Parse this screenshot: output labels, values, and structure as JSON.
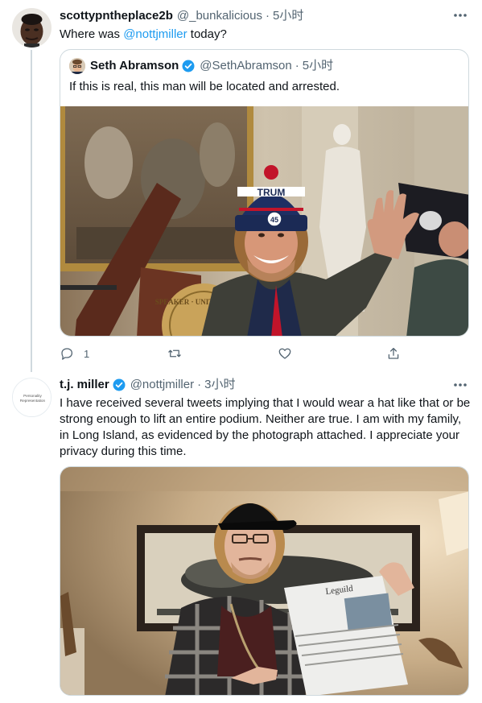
{
  "tweet1": {
    "author_name": "scottypntheplace2b",
    "author_handle": "@_bunkalicious",
    "separator": "·",
    "time": "5小时",
    "text_before": "Where was ",
    "mention": "@nottjmiller",
    "text_after": " today?",
    "quote": {
      "author_name": "Seth Abramson",
      "author_handle": "@SethAbramson",
      "separator": "·",
      "time": "5小时",
      "text": "If this is real, this man will be located and arrested.",
      "photo_lettering": {
        "hat": "TRUM",
        "hat_badge": "45",
        "seal": "SPEAKER · UNITED STATES"
      }
    },
    "actions": {
      "reply_count": "1",
      "retweet_count": "",
      "like_count": ""
    }
  },
  "tweet2": {
    "author_name": "t.j. miller",
    "author_handle": "@nottjmiller",
    "separator": "·",
    "time": "3小时",
    "avatar_text": [
      "Personality",
      "Representation"
    ],
    "text": "I have received several tweets implying that I would wear a hat like that or be strong enough to lift an entire podium. Neither are true. I am with my family, in Long Island, as evidenced by the photograph attached. I appreciate your privacy during this time.",
    "photo_lettering": {
      "newspaper_masthead": "Leguild"
    }
  },
  "icons": {
    "more": "more-horizontal-icon",
    "verified": "verified-badge-icon",
    "reply": "reply-icon",
    "retweet": "retweet-icon",
    "like": "like-heart-icon",
    "share": "share-icon"
  },
  "colors": {
    "accent": "#1d9bf0",
    "text": "#0f1419",
    "muted": "#536471",
    "border": "#cfd9de"
  }
}
